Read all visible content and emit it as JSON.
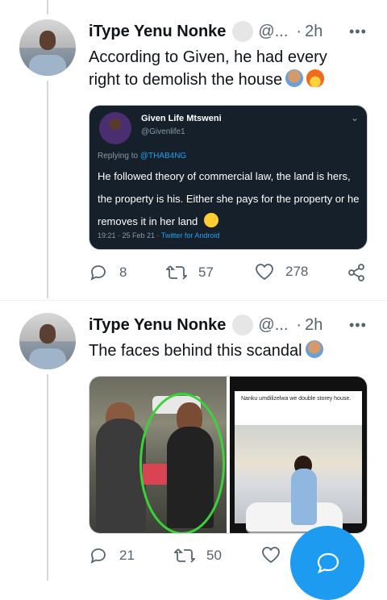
{
  "tweets": [
    {
      "author_name": "iType Yenu Nonke",
      "handle": "@...",
      "dot": "·",
      "time": "2h",
      "more": "•••",
      "text": "According to Given, he had every right to demolish the house",
      "quote": {
        "author_name": "Given Life Mtsweni",
        "handle": "@Givenlife1",
        "reply_prefix": "Replying to",
        "reply_to": "@THAB4NG",
        "text": "He followed theory of commercial law, the land is hers, the property is his. Either she pays for the property or he removes it in her land",
        "meta_time": "19:21 · 25 Feb 21 ·",
        "meta_source": "Twitter for Android"
      },
      "actions": {
        "replies": "8",
        "retweets": "57",
        "likes": "278"
      }
    },
    {
      "author_name": "iType Yenu Nonke",
      "handle": "@...",
      "dot": "·",
      "time": "2h",
      "more": "•••",
      "text": "The faces behind this scandal",
      "media_caption": "Nanku umdilizelwa we double storey house.",
      "actions": {
        "replies": "21",
        "retweets": "50"
      }
    }
  ],
  "icons": [
    "reply-icon",
    "retweet-icon",
    "like-icon",
    "share-icon",
    "compose-icon"
  ],
  "colors": {
    "accent": "#1d9bf0",
    "muted": "#536471",
    "embed_bg": "#15202b"
  }
}
